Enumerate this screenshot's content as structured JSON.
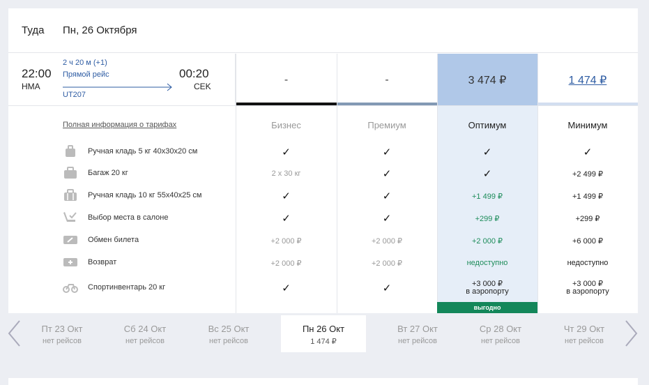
{
  "header": {
    "direction": "Туда",
    "date": "Пн, 26 Октября"
  },
  "flight": {
    "dep_time": "22:00",
    "dep_code": "HMA",
    "arr_time": "00:20",
    "arr_code": "CEK",
    "duration": "2 ч 20 м (+1)",
    "type": "Прямой рейс",
    "number": "UT207"
  },
  "prices": {
    "business": "-",
    "premium": "-",
    "optimum": "3 474 ₽",
    "minimum": "1 474 ₽"
  },
  "tariff_link": "Полная информация о тарифах",
  "classes": {
    "business": "Бизнес",
    "premium": "Премиум",
    "optimum": "Оптимум",
    "minimum": "Минимум"
  },
  "features": [
    {
      "icon": "carry-on-bag-icon",
      "label": "Ручная кладь 5 кг 40x30x20 см",
      "business": "✓",
      "premium": "✓",
      "optimum": "✓",
      "minimum": "✓"
    },
    {
      "icon": "suitcase-icon",
      "label": "Багаж 20 кг",
      "business": "2 x 30 кг",
      "premium": "✓",
      "optimum": "✓",
      "minimum": "+2 499 ₽"
    },
    {
      "icon": "suitcase-large-icon",
      "label": "Ручная кладь 10 кг 55x40x25 см",
      "business": "✓",
      "premium": "✓",
      "optimum": "+1 499 ₽",
      "minimum": "+1 499 ₽"
    },
    {
      "icon": "seat-icon",
      "label": "Выбор места в салоне",
      "business": "✓",
      "premium": "✓",
      "optimum": "+299 ₽",
      "minimum": "+299 ₽"
    },
    {
      "icon": "ticket-exchange-icon",
      "label": "Обмен билета",
      "business": "+2 000 ₽",
      "premium": "+2 000 ₽",
      "optimum": "+2 000 ₽",
      "minimum": "+6 000 ₽"
    },
    {
      "icon": "ticket-refund-icon",
      "label": "Возврат",
      "business": "+2 000 ₽",
      "premium": "+2 000 ₽",
      "optimum": "недоступно",
      "minimum": "недоступно"
    },
    {
      "icon": "bicycle-icon",
      "label": "Спортинвентарь 20 кг",
      "business": "✓",
      "premium": "✓",
      "optimum_line1": "+3 000 ₽",
      "optimum_line2": "в аэропорту",
      "minimum_line1": "+3 000 ₽",
      "minimum_line2": "в аэропорту"
    }
  ],
  "badge": "выгодно",
  "date_nav": [
    {
      "date": "Пт 23 Окт",
      "sub": "нет рейсов"
    },
    {
      "date": "Сб 24 Окт",
      "sub": "нет рейсов"
    },
    {
      "date": "Вс 25 Окт",
      "sub": "нет рейсов"
    },
    {
      "date": "Пн 26 Окт",
      "sub": "1 474 ₽"
    },
    {
      "date": "Вт 27 Окт",
      "sub": "нет рейсов"
    },
    {
      "date": "Ср 28 Окт",
      "sub": "нет рейсов"
    },
    {
      "date": "Чт 29 Окт",
      "sub": "нет рейсов"
    }
  ],
  "colors": {
    "accent": "#2e5ca3",
    "selected_price": "#b0c8e8",
    "selected_col": "#e6eef8",
    "green": "#1d8c5a",
    "badge": "#13875a"
  }
}
